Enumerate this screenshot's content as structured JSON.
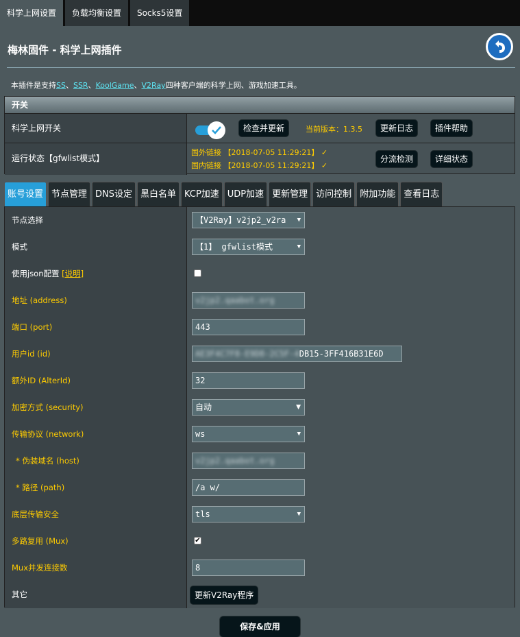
{
  "top_tabs": [
    "科学上网设置",
    "负载均衡设置",
    "Socks5设置"
  ],
  "title": "梅林固件 - 科学上网插件",
  "description": {
    "prefix": "本插件是支持",
    "links": [
      "SS",
      "SSR",
      "KoolGame",
      "V2Ray"
    ],
    "sep": "、",
    "suffix": "四种客户端的科学上网、游戏加速工具。"
  },
  "switch_panel": {
    "header": "开关",
    "switch_label": "科学上网开关",
    "switch_on": true,
    "check_update": "检查并更新",
    "version_text": "当前版本：1.3.5",
    "changelog": "更新日志",
    "plugin_help": "插件帮助",
    "status_label": "运行状态【gfwlist模式】",
    "status_foreign": "国外链接 【2018-07-05 11:29:21】 ✓",
    "status_domestic": "国内链接 【2018-07-05 11:29:21】 ✓",
    "split_check": "分流检测",
    "detail_status": "详细状态"
  },
  "tabs": [
    "账号设置",
    "节点管理",
    "DNS设定",
    "黑白名单",
    "KCP加速",
    "UDP加速",
    "更新管理",
    "访问控制",
    "附加功能",
    "查看日志"
  ],
  "active_tab": 0,
  "form": {
    "node_label": "节点选择",
    "node_value": "【V2Ray】v2jp2_v2ra",
    "mode_label": "模式",
    "mode_value": "【1】 gfwlist模式",
    "json_label": "使用json配置",
    "json_link": "[说明]",
    "json_checked": false,
    "address_label": "地址 (address)",
    "address_value": "v2jp2.qaabot.org",
    "port_label": "端口 (port)",
    "port_value": "443",
    "uid_label": "用户id (id)",
    "uid_hidden": "AE3F4C7F8-E9D8-2C5F-4",
    "uid_visible": "DB15-3FF416B31E6D",
    "alterid_label": "额外ID (AlterId)",
    "alterid_value": "32",
    "security_label": "加密方式 (security)",
    "security_value": "自动",
    "network_label": "传输协议 (network)",
    "network_value": "ws",
    "host_label": "* 伪装域名 (host)",
    "host_value": "v2jp2.qaabot.org",
    "path_label": "* 路径 (path)",
    "path_value": "/a  w/",
    "tls_label": "底层传输安全",
    "tls_value": "tls",
    "mux_label": "多路复用 (Mux)",
    "mux_checked": true,
    "muxconc_label": "Mux并发连接数",
    "muxconc_value": "8",
    "other_label": "其它",
    "update_v2ray": "更新V2Ray程序"
  },
  "save_button": "保存&应用",
  "colors": {
    "accent": "#279fd9",
    "label_yellow": "#ffcc00",
    "link_cyan": "#5ee7f6",
    "background": "#4d595d"
  }
}
